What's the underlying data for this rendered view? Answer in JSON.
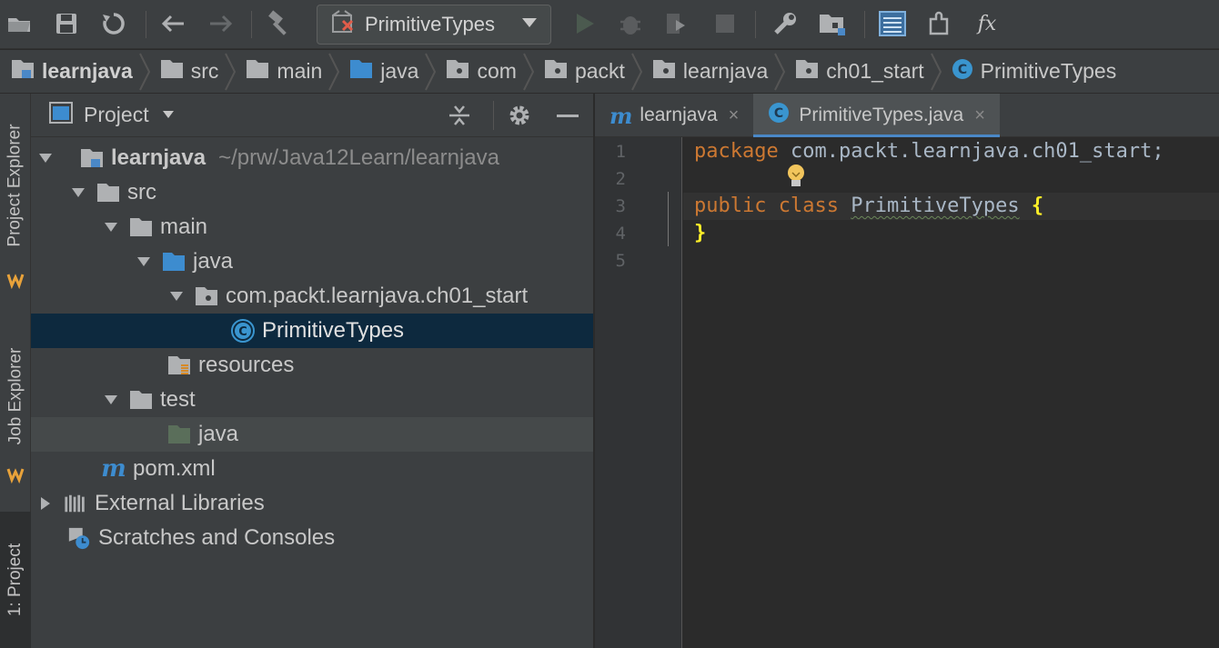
{
  "toolbar": {
    "run_config_label": "PrimitiveTypes",
    "fx_label": "fx"
  },
  "breadcrumbs": [
    "learnjava",
    "src",
    "main",
    "java",
    "com",
    "packt",
    "learnjava",
    "ch01_start",
    "PrimitiveTypes"
  ],
  "side_tabs": {
    "project_explorer": "Project Explorer",
    "job_explorer": "Job Explorer",
    "project": "1: Project"
  },
  "project_panel": {
    "title": "Project",
    "tree": [
      {
        "label": "learnjava",
        "path": "~/prw/Java12Learn/learnjava"
      },
      {
        "label": "src"
      },
      {
        "label": "main"
      },
      {
        "label": "java"
      },
      {
        "label": "com.packt.learnjava.ch01_start"
      },
      {
        "label": "PrimitiveTypes"
      },
      {
        "label": "resources"
      },
      {
        "label": "test"
      },
      {
        "label": "java"
      },
      {
        "label": "pom.xml"
      },
      {
        "label": "External Libraries"
      },
      {
        "label": "Scratches and Consoles"
      }
    ]
  },
  "editor": {
    "tabs": [
      {
        "label": "learnjava",
        "close": "×"
      },
      {
        "label": "PrimitiveTypes.java",
        "close": "×"
      }
    ],
    "line_numbers": [
      "1",
      "2",
      "3",
      "4",
      "5"
    ],
    "code": {
      "l1_kw": "package",
      "l1_rest": " com.packt.learnjava.ch01_start;",
      "l3_kw1": "public",
      "l3_kw2": "class",
      "l3_class": "PrimitiveTypes",
      "l3_brace": "{",
      "l4_brace": "}"
    }
  },
  "colors": {
    "accent": "#4a88c7",
    "keyword": "#cc7832",
    "brace_highlight": "#ffef28",
    "selection": "#0d293e"
  }
}
